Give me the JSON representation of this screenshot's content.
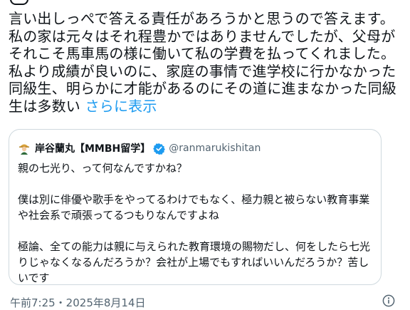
{
  "tweet": {
    "text": "言い出しっぺで答える責任があろうかと思うので答えます。私の家は元々はそれ程豊かではありませんでしたが、父母がそれこそ馬車馬の様に働いて私の学費を払ってくれました。私より成績が良いのに、家庭の事情で進学校に行かなかった同級生、明らかに才能があるのにその道に進まなかった同級生は多数い",
    "show_more": "さらに表示",
    "timestamp": "午前7:25・2025年8月14日"
  },
  "quote": {
    "name": "岸谷蘭丸【MMBH留学】",
    "handle": "@ranmarukishitan",
    "paragraphs": [
      "親の七光り、って何なんですかね？",
      "僕は別に俳優や歌手をやってるわけでもなく、極力親と被らない教育事業や社会系で頑張ってるつもりなんですよね",
      "極論、全ての能力は親に与えられた教育環境の賜物だし、何をしたら七光りじゃなくなるんだろうか？会社が上場でもすればいいんだろうか？苦しいです"
    ]
  },
  "icons": {
    "avatar": "person-with-hat-avatar-icon",
    "verified": "verified-badge-icon",
    "info": "info-circle-icon"
  },
  "colors": {
    "link": "#1d9bf0",
    "text": "#0f1419",
    "secondary": "#536471",
    "border": "#cfd9de"
  }
}
